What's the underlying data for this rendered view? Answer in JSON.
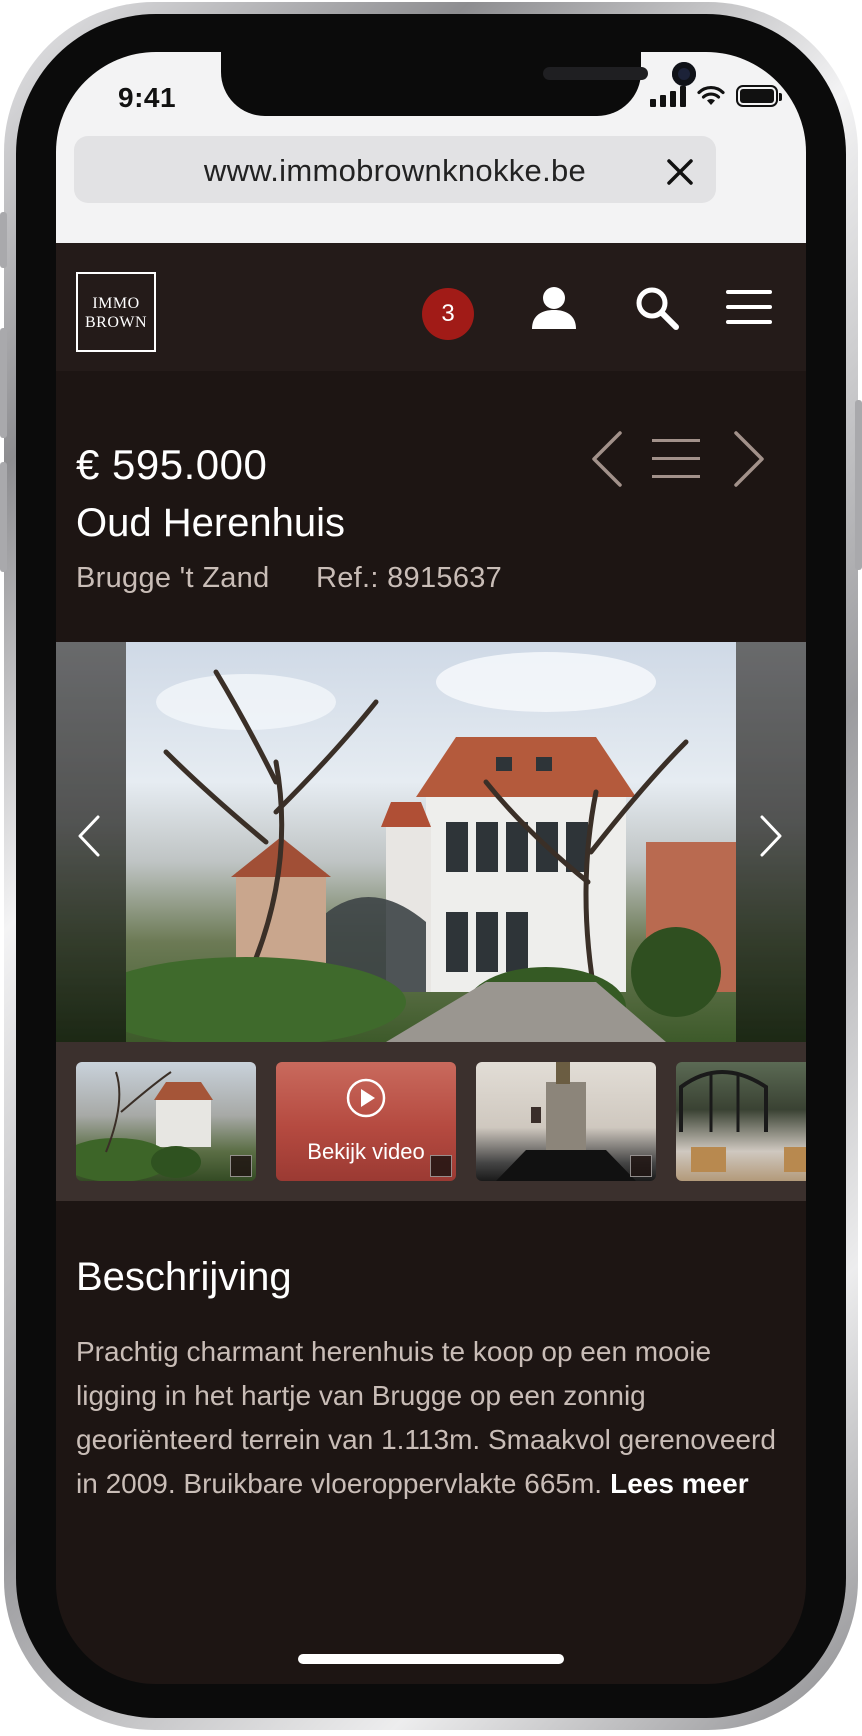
{
  "status_bar": {
    "time": "9:41"
  },
  "browser": {
    "url": "www.immobrownknokke.be"
  },
  "site_header": {
    "logo_line1": "IMMO",
    "logo_line2": "BROWN",
    "badge_count": "3",
    "icons": [
      "user-icon",
      "search-icon",
      "menu-icon"
    ]
  },
  "property": {
    "price": "€ 595.000",
    "title": "Oud Herenhuis",
    "location": "Brugge 't Zand",
    "reference": "Ref.: 8915637"
  },
  "thumbnails": {
    "video_label": "Bekijk video"
  },
  "description": {
    "title": "Beschrijving",
    "text": "Prachtig charmant herenhuis te koop op een mooie ligging in het hartje van Brugge op een zonnig georiënteerd terrein van 1.113m. Smaakvol gerenoveerd in 2009. Bruikbare vloeroppervlakte 665m.",
    "read_more": "Lees meer"
  },
  "colors": {
    "site_bg": "#1d1513",
    "header_bg": "#241b19",
    "badge": "#a11b17",
    "muted_text": "#c9bdb7"
  }
}
